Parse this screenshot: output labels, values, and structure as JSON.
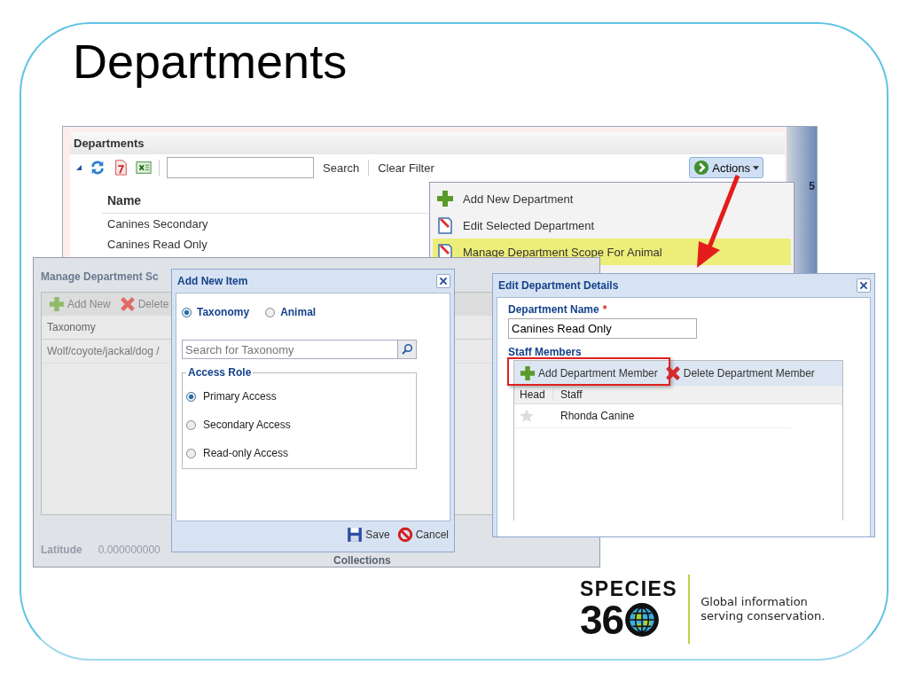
{
  "slide": {
    "title": "Departments"
  },
  "departments_window": {
    "title": "Departments",
    "search_button": "Search",
    "clear_filter": "Clear Filter",
    "actions_button": "Actions",
    "column": "Name",
    "rows": [
      "Canines Secondary",
      "Canines Read Only"
    ],
    "side_label": "5"
  },
  "actions_menu": [
    {
      "label": "Add New Department",
      "kind": "add",
      "selected": false
    },
    {
      "label": "Edit Selected Department",
      "kind": "edit",
      "selected": false
    },
    {
      "label": "Manage Department Scope For Animal",
      "kind": "edit",
      "selected": true
    }
  ],
  "manage_window": {
    "title": "Manage Department Sc",
    "toolbar": [
      {
        "label": "Add New",
        "kind": "add"
      },
      {
        "label": "Delete",
        "kind": "delete"
      }
    ],
    "column": "Taxonomy",
    "rows": [
      "Wolf/coyote/jackal/dog /"
    ],
    "latitude_label": "Latitude",
    "latitude_value": "0.000000000",
    "collections": "Collections"
  },
  "add_item_dialog": {
    "title": "Add New Item",
    "types": [
      {
        "label": "Taxonomy",
        "selected": true
      },
      {
        "label": "Animal",
        "selected": false
      }
    ],
    "search": {
      "placeholder": "Search for Taxonomy"
    },
    "access_role": {
      "legend": "Access Role",
      "options": [
        {
          "label": "Primary Access",
          "selected": true
        },
        {
          "label": "Secondary Access",
          "selected": false
        },
        {
          "label": "Read-only Access",
          "selected": false
        }
      ]
    },
    "buttons": [
      {
        "label": "Save",
        "kind": "save"
      },
      {
        "label": "Cancel",
        "kind": "cancel"
      }
    ]
  },
  "edit_dialog": {
    "title": "Edit Department Details",
    "name_label": "Department Name",
    "required_mark": "*",
    "name_value": "Canines Read Only",
    "staff_label": "Staff Members",
    "toolbar": [
      {
        "label": "Add Department Member",
        "kind": "add",
        "highlighted": true
      },
      {
        "label": "Delete Department Member",
        "kind": "delete",
        "highlighted": false
      }
    ],
    "columns": [
      "Head",
      "Staff"
    ],
    "rows": [
      {
        "head": false,
        "staff": "Rhonda Canine"
      }
    ]
  },
  "logo": {
    "line1": "SPECIES",
    "line2": "36",
    "tagline": [
      "Global information",
      "serving conservation."
    ]
  }
}
